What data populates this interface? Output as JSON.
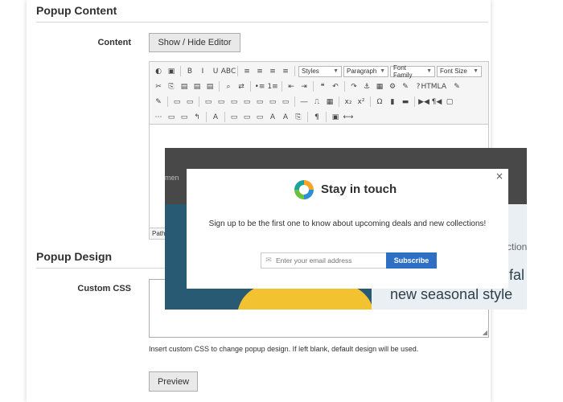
{
  "sections": {
    "content_title": "Popup Content",
    "design_title": "Popup Design"
  },
  "content": {
    "label": "Content",
    "toggle_button": "Show / Hide Editor"
  },
  "editor": {
    "row1_icons": [
      "html-icon",
      "template-icon",
      "bold-icon",
      "italic-icon",
      "underline-icon",
      "strikethrough-icon",
      "align-left-icon",
      "align-center-icon",
      "align-right-icon",
      "align-justify-icon"
    ],
    "row1_glyphs": [
      "◐",
      "▣",
      "B",
      "I",
      "U",
      "ABC",
      "≡",
      "≡",
      "≡",
      "≡"
    ],
    "selects": [
      "Styles",
      "Paragraph",
      "Font Family",
      "Font Size"
    ],
    "row2_glyphs": [
      "✂",
      "⎘",
      "▤",
      "▤",
      "▤",
      "⌕",
      "⇄",
      "•≡",
      "1≡",
      "⇤",
      "⇥",
      "❝",
      "↶",
      "↷",
      "⚓",
      "▦",
      "⚙",
      "✎",
      "?",
      "HTML",
      "A",
      "✎"
    ],
    "row3_glyphs": [
      "✎",
      "▭",
      "▭",
      "▭",
      "▭",
      "▭",
      "▭",
      "▭",
      "▭",
      "▭",
      "―",
      "⎍",
      "▦",
      "x₂",
      "x²",
      "Ω",
      "▮",
      "▬",
      "▶◀",
      "¶◀",
      "▢"
    ],
    "row4_glyphs": [
      "⋯",
      "▭",
      "▭",
      "↰",
      "A",
      "▭",
      "▭",
      "▭",
      "A",
      "A",
      "⎘",
      "¶",
      "▣",
      "⟷"
    ],
    "path_label": "Path"
  },
  "design": {
    "label": "Custom CSS",
    "note": "Insert custom CSS to change popup design. If left blank, default design will be used.",
    "preview_button": "Preview"
  },
  "preview_bg": {
    "fragment_left": "men",
    "fragment_right_small": "ction",
    "line1": "fal",
    "line2": "new seasonal style"
  },
  "popup": {
    "close": "×",
    "title": "Stay in touch",
    "text": "Sign up to be the first one to know about upcoming deals and new collections!",
    "email_placeholder": "Enter your email address",
    "subscribe_label": "Subscribe"
  }
}
